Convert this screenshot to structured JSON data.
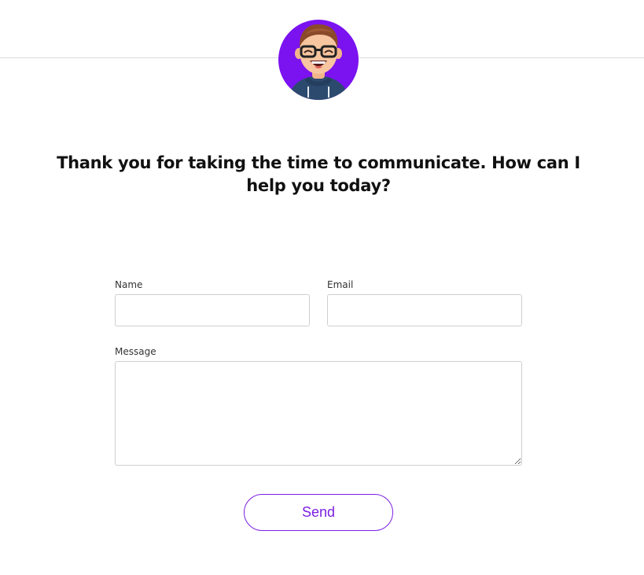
{
  "avatar": {
    "icon": "smiling-man-with-glasses-avatar",
    "background_color": "#7b12f0"
  },
  "heading": "Thank you for taking the time to communicate. How can I help you today?",
  "form": {
    "name_label": "Name",
    "name_value": "",
    "email_label": "Email",
    "email_value": "",
    "message_label": "Message",
    "message_value": "",
    "send_label": "Send"
  },
  "colors": {
    "accent": "#7b1fe3",
    "divider": "#dcdcdc",
    "input_border": "#cfcfcf"
  }
}
